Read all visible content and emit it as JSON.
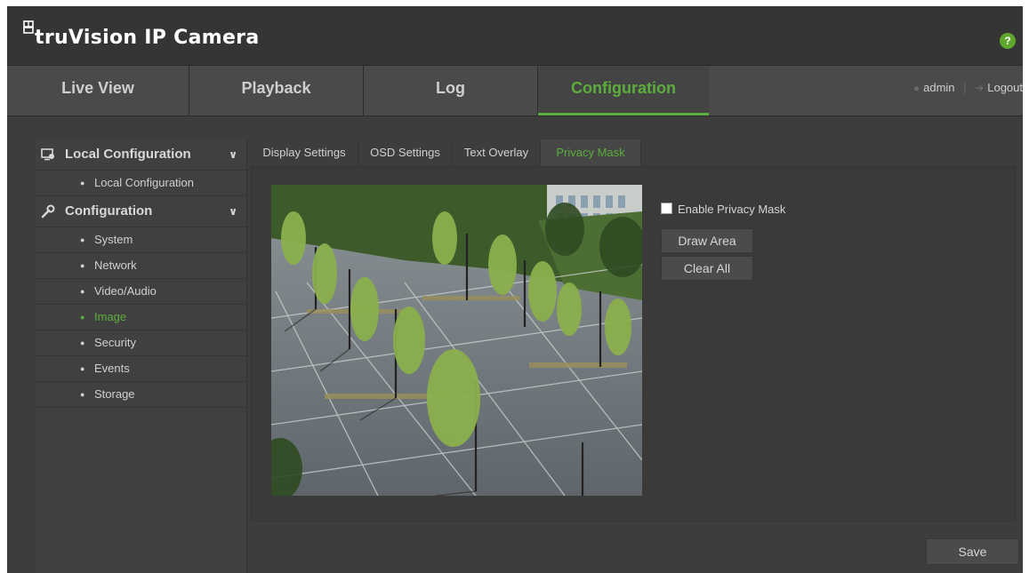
{
  "header": {
    "brand": "truVision IP Camera",
    "help_label": "?"
  },
  "nav": {
    "tabs": [
      {
        "label": "Live View"
      },
      {
        "label": "Playback"
      },
      {
        "label": "Log"
      },
      {
        "label": "Configuration",
        "active": true
      }
    ],
    "user": "admin",
    "separator": "|",
    "logout": "Logout"
  },
  "sidebar": {
    "sections": [
      {
        "label": "Local Configuration",
        "icon": "local-config-icon",
        "items": [
          {
            "label": "Local Configuration"
          }
        ]
      },
      {
        "label": "Configuration",
        "icon": "wrench-icon",
        "items": [
          {
            "label": "System"
          },
          {
            "label": "Network"
          },
          {
            "label": "Video/Audio"
          },
          {
            "label": "Image",
            "active": true
          },
          {
            "label": "Security"
          },
          {
            "label": "Events"
          },
          {
            "label": "Storage"
          }
        ]
      }
    ]
  },
  "content": {
    "tabs": [
      {
        "label": "Display Settings"
      },
      {
        "label": "OSD Settings"
      },
      {
        "label": "Text Overlay"
      },
      {
        "label": "Privacy Mask",
        "active": true
      }
    ],
    "enable_label": "Enable Privacy Mask",
    "enable_checked": false,
    "draw_area": "Draw Area",
    "clear_all": "Clear All",
    "save": "Save"
  },
  "colors": {
    "accent": "#5cae3c",
    "background": "#3d3d3d",
    "header": "#353535"
  }
}
